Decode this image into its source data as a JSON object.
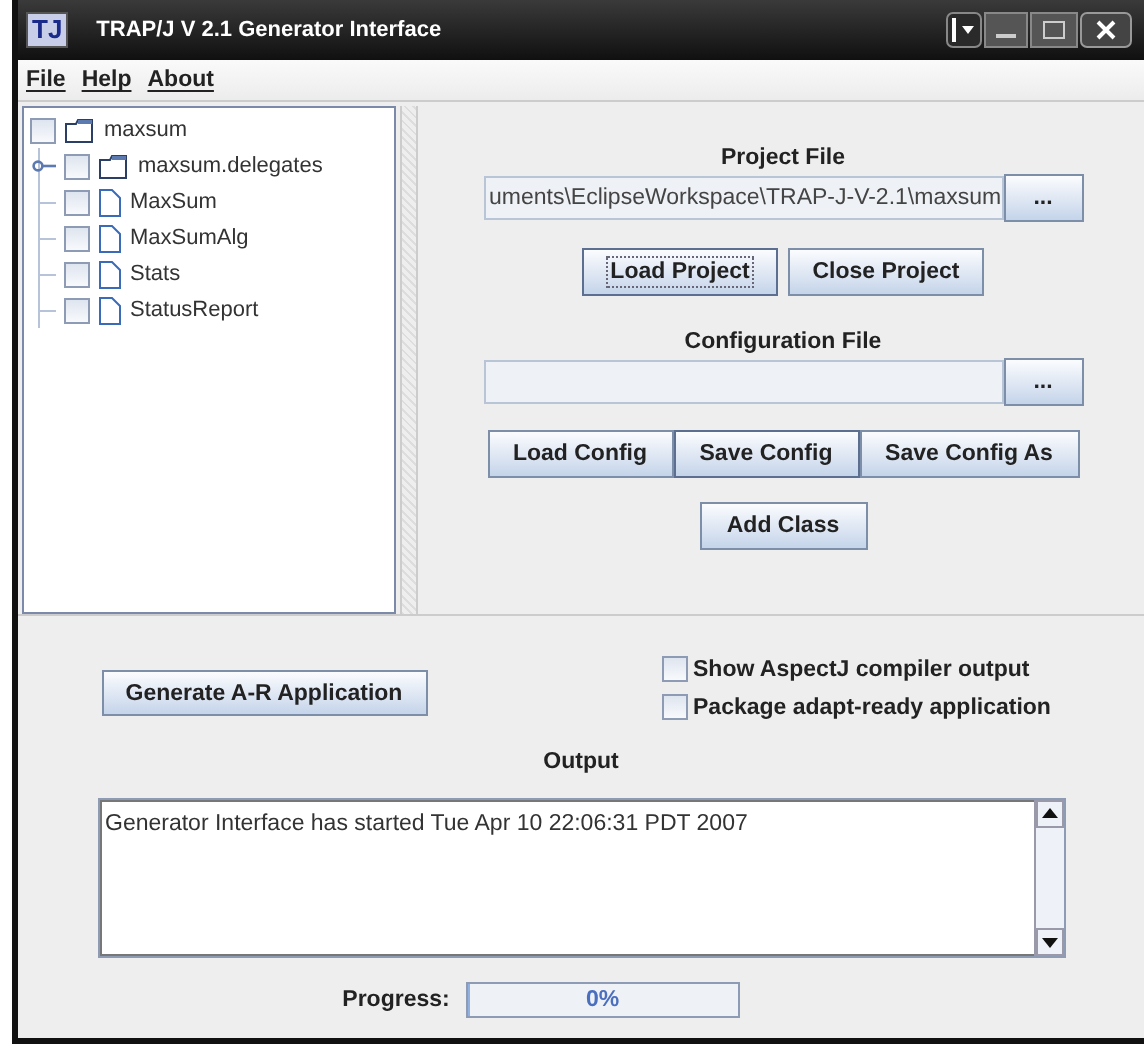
{
  "window": {
    "title": "TRAP/J V 2.1 Generator Interface",
    "logo": "TJ"
  },
  "menu": [
    "File",
    "Help",
    "About"
  ],
  "tree": {
    "label": "maxsum",
    "kind": "folder",
    "checked": false,
    "children": [
      {
        "label": "maxsum.delegates",
        "kind": "folder",
        "checked": false,
        "expanded": false
      },
      {
        "label": "MaxSum",
        "kind": "file",
        "checked": false
      },
      {
        "label": "MaxSumAlg",
        "kind": "file",
        "checked": false
      },
      {
        "label": "Stats",
        "kind": "file",
        "checked": false
      },
      {
        "label": "StatusReport",
        "kind": "file",
        "checked": false
      }
    ]
  },
  "project_file": {
    "label": "Project File",
    "value": "uments\\EclipseWorkspace\\TRAP-J-V-2.1\\maxsum",
    "browse": "...",
    "buttons": [
      {
        "label": "Load Project",
        "focused": true
      },
      {
        "label": "Close Project",
        "focused": false
      }
    ]
  },
  "config_file": {
    "label": "Configuration File",
    "browse": "...",
    "buttons": [
      {
        "label": "Load Config",
        "focused": false
      },
      {
        "label": "Save Config",
        "focused": true
      },
      {
        "label": "Save Config As",
        "focused": false
      }
    ]
  },
  "add_class": "Add Class",
  "generate": "Generate A-R Application",
  "options": [
    {
      "label": "Show AspectJ compiler output",
      "checked": false
    },
    {
      "label": "Package adapt-ready application",
      "checked": false
    }
  ],
  "output": {
    "label": "Output",
    "lines": [
      "Generator Interface has started Tue Apr 10 22:06:31 PDT 2007"
    ]
  },
  "progress": {
    "label": "Progress:",
    "level": 0,
    "reading": "0%"
  }
}
